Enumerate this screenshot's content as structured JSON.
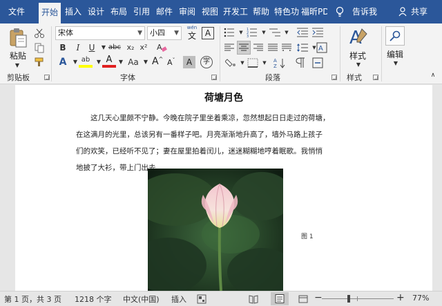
{
  "tabs": {
    "file": "文件",
    "home": "开始",
    "insert": "插入",
    "design": "设计",
    "layout": "布局",
    "references": "引用",
    "mailings": "邮件",
    "review": "审阅",
    "view": "视图",
    "developer": "开发工",
    "help": "帮助",
    "special": "特色功",
    "foxit": "福昕PD",
    "tell_me": "告诉我",
    "share": "共享"
  },
  "ribbon": {
    "clipboard": {
      "paste": "粘贴",
      "group": "剪贴板"
    },
    "font": {
      "font_name": "宋体",
      "font_size": "小四",
      "wen_top": "wén",
      "wen_bottom": "文",
      "A_box": "A",
      "bold": "B",
      "italic": "I",
      "underline": "U",
      "strike": "abc",
      "subscript": "x₂",
      "superscript": "x²",
      "text_effect": "A",
      "highlight_glyph": "ab",
      "font_color": "A",
      "change_case": "Aa",
      "grow": "A",
      "shrink": "A",
      "char_shading": "A",
      "enclose": "字",
      "group": "字体"
    },
    "paragraph": {
      "group": "段落"
    },
    "styles": {
      "styles": "样式",
      "group": "样式"
    },
    "editing": {
      "editing": "编辑"
    }
  },
  "document": {
    "title": "荷塘月色",
    "lines": [
      "这几天心里颇不宁静。今晚在院子里坐着乘凉，忽然想起日日走过的荷塘，",
      "在这满月的光里，总该另有一番样子吧。月亮渐渐地升高了，墙外马路上孩子",
      "们的欢笑，已经听不见了；妻在屋里拍着闰儿，迷迷糊糊地哼着眠歌。我悄悄",
      "地披了大衫，带上门出去。"
    ],
    "caption": "图 1"
  },
  "status": {
    "page": "第 1 页，共 3 页",
    "words": "1218 个字",
    "language": "中文(中国)",
    "mode": "插入",
    "zoom_minus": "−",
    "zoom_plus": "+",
    "zoom": "77%",
    "zoom_fraction": 0.77
  },
  "colors": {
    "accent": "#2b579a",
    "highlight": "#ffff00",
    "font_color": "#e02020"
  }
}
